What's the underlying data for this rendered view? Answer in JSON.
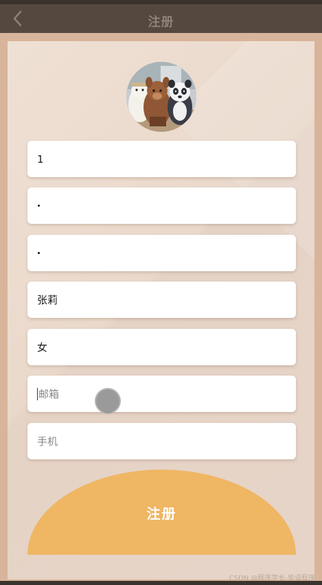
{
  "header": {
    "title": "注册",
    "back_icon": "chevron-left-icon"
  },
  "form": {
    "fields": [
      {
        "name": "username",
        "value": "1",
        "placeholder": ""
      },
      {
        "name": "password",
        "value": "•",
        "placeholder": "",
        "masked": true
      },
      {
        "name": "confirm_password",
        "value": "•",
        "placeholder": "",
        "masked": true
      },
      {
        "name": "real_name",
        "value": "张莉",
        "placeholder": ""
      },
      {
        "name": "gender",
        "value": "女",
        "placeholder": ""
      },
      {
        "name": "email",
        "value": "",
        "placeholder": "邮箱"
      },
      {
        "name": "phone",
        "value": "",
        "placeholder": "手机"
      }
    ],
    "submit_label": "注册"
  },
  "watermark": "CSDN @程序学长-毕设程序",
  "colors": {
    "navbar": "#54483f",
    "frame": "#d8b49b",
    "panel": "#ecdccf",
    "submit": "#efb664"
  }
}
